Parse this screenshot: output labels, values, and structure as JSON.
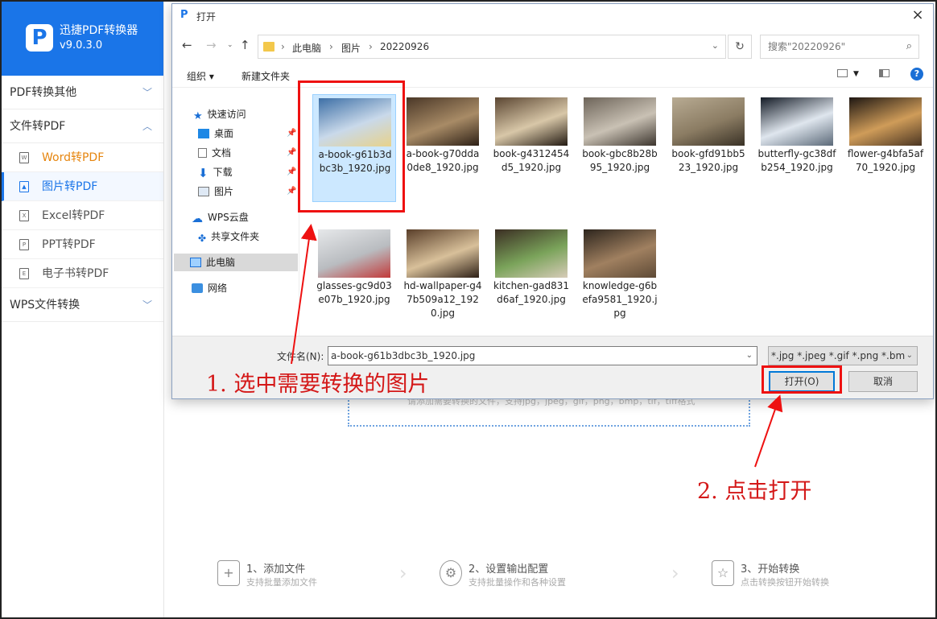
{
  "app": {
    "name": "迅捷PDF转换器",
    "version": "v9.0.3.0",
    "logo_letter": "P",
    "accent": "#1a75e8",
    "sidebar": {
      "groups": [
        {
          "label": "PDF转换其他",
          "expanded": false
        },
        {
          "label": "文件转PDF",
          "expanded": true
        },
        {
          "label": "WPS文件转换",
          "expanded": false
        }
      ],
      "items": [
        {
          "label": "Word转PDF",
          "icon": "word-doc-icon"
        },
        {
          "label": "图片转PDF",
          "icon": "image-icon",
          "active": true
        },
        {
          "label": "Excel转PDF",
          "icon": "excel-doc-icon"
        },
        {
          "label": "PPT转PDF",
          "icon": "ppt-doc-icon"
        },
        {
          "label": "电子书转PDF",
          "icon": "ebook-icon"
        }
      ]
    },
    "dropzone_hint": "请添加需要转换的文件，支持jpg，jpeg，gif，png，bmp，tif，tiff格式",
    "steps": [
      {
        "title": "1、添加文件",
        "desc": "支持批量添加文件",
        "icon": "add-file-icon"
      },
      {
        "title": "2、设置输出配置",
        "desc": "支持批量操作和各种设置",
        "icon": "settings-gear-icon"
      },
      {
        "title": "3、开始转换",
        "desc": "点击转换按钮开始转换",
        "icon": "convert-icon"
      }
    ]
  },
  "dialog": {
    "title": "打开",
    "breadcrumb": [
      "此电脑",
      "图片",
      "20220926"
    ],
    "search_placeholder": "搜索\"20220926\"",
    "toolbar": {
      "organize": "组织",
      "new_folder": "新建文件夹"
    },
    "nav": {
      "quick_access": "快速访问",
      "desktop": "桌面",
      "documents": "文档",
      "downloads": "下载",
      "pictures": "图片",
      "wps_cloud": "WPS云盘",
      "shared": "共享文件夹",
      "this_pc": "此电脑",
      "network": "网络"
    },
    "files": [
      {
        "name": "a-book-g61b3dbc3b_1920.jpg",
        "selected": true,
        "colors": [
          "#3d6fa6",
          "#c9d9ea",
          "#e7d28b"
        ]
      },
      {
        "name": "a-book-g70dda0de8_1920.jpg",
        "colors": [
          "#4a3727",
          "#a88b66",
          "#2d2016"
        ]
      },
      {
        "name": "book-g4312454d5_1920.jpg",
        "colors": [
          "#5b4632",
          "#d8c7a8",
          "#231a12"
        ]
      },
      {
        "name": "book-gbc8b28b95_1920.jpg",
        "colors": [
          "#6d6459",
          "#c9c1b4",
          "#3c352e"
        ]
      },
      {
        "name": "book-gfd91bb523_1920.jpg",
        "colors": [
          "#b8ab93",
          "#8b7c63",
          "#3a3226"
        ]
      },
      {
        "name": "butterfly-gc38dfb254_1920.jpg",
        "colors": [
          "#141b26",
          "#dfe6ee",
          "#5b6978"
        ]
      },
      {
        "name": "flower-g4bfa5af70_1920.jpg",
        "colors": [
          "#1e1712",
          "#cf9c59",
          "#4a3522"
        ]
      },
      {
        "name": "glasses-gc9d03e07b_1920.jpg",
        "colors": [
          "#e6e8ea",
          "#b9bcc0",
          "#c23a3a"
        ]
      },
      {
        "name": "hd-wallpaper-g47b509a12_1920.jpg",
        "colors": [
          "#5a3f2a",
          "#d8c09a",
          "#2e2017"
        ]
      },
      {
        "name": "kitchen-gad831d6af_1920.jpg",
        "colors": [
          "#3b2e23",
          "#7aa35a",
          "#d7cbb8"
        ]
      },
      {
        "name": "knowledge-g6befa9581_1920.jpg",
        "colors": [
          "#2d251d",
          "#a08060",
          "#5e4a36"
        ]
      }
    ],
    "filename_label": "文件名(N):",
    "filename_value": "a-book-g61b3dbc3b_1920.jpg",
    "filetype": "*.jpg *.jpeg *.gif *.png *.bmp",
    "open_button": "打开(O)",
    "cancel_button": "取消"
  },
  "annotations": {
    "step1": "1. 选中需要转换的图片",
    "step2": "2. 点击打开",
    "color": "#e11111"
  }
}
